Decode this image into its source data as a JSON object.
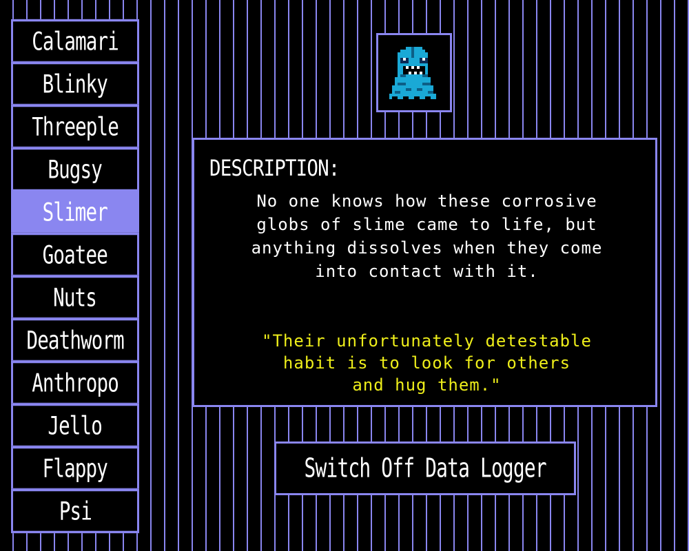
{
  "roster": {
    "items": [
      {
        "label": "Calamari"
      },
      {
        "label": "Blinky"
      },
      {
        "label": "Threeple"
      },
      {
        "label": "Bugsy"
      },
      {
        "label": "Slimer"
      },
      {
        "label": "Goatee"
      },
      {
        "label": "Nuts"
      },
      {
        "label": "Deathworm"
      },
      {
        "label": "Anthropo"
      },
      {
        "label": "Jello"
      },
      {
        "label": "Flappy"
      },
      {
        "label": "Psi"
      }
    ],
    "selected": "Slimer"
  },
  "portrait": {
    "icon": "slime-creature-icon"
  },
  "description": {
    "heading": "DESCRIPTION:",
    "body_lines": [
      "No one knows how these corrosive",
      "globs of slime came to life, but",
      "anything dissolves when they come",
      "into contact with it."
    ],
    "quote_lines": [
      "\"Their unfortunately detestable",
      "habit is to look for others",
      "and hug them.\""
    ]
  },
  "actions": {
    "switch_off_label": "Switch Off Data Logger"
  },
  "colors": {
    "accent": "#8a86f0",
    "background": "#000000",
    "text": "#ffffff",
    "quote": "#eeee1a",
    "creature": "#1aa9d6"
  }
}
